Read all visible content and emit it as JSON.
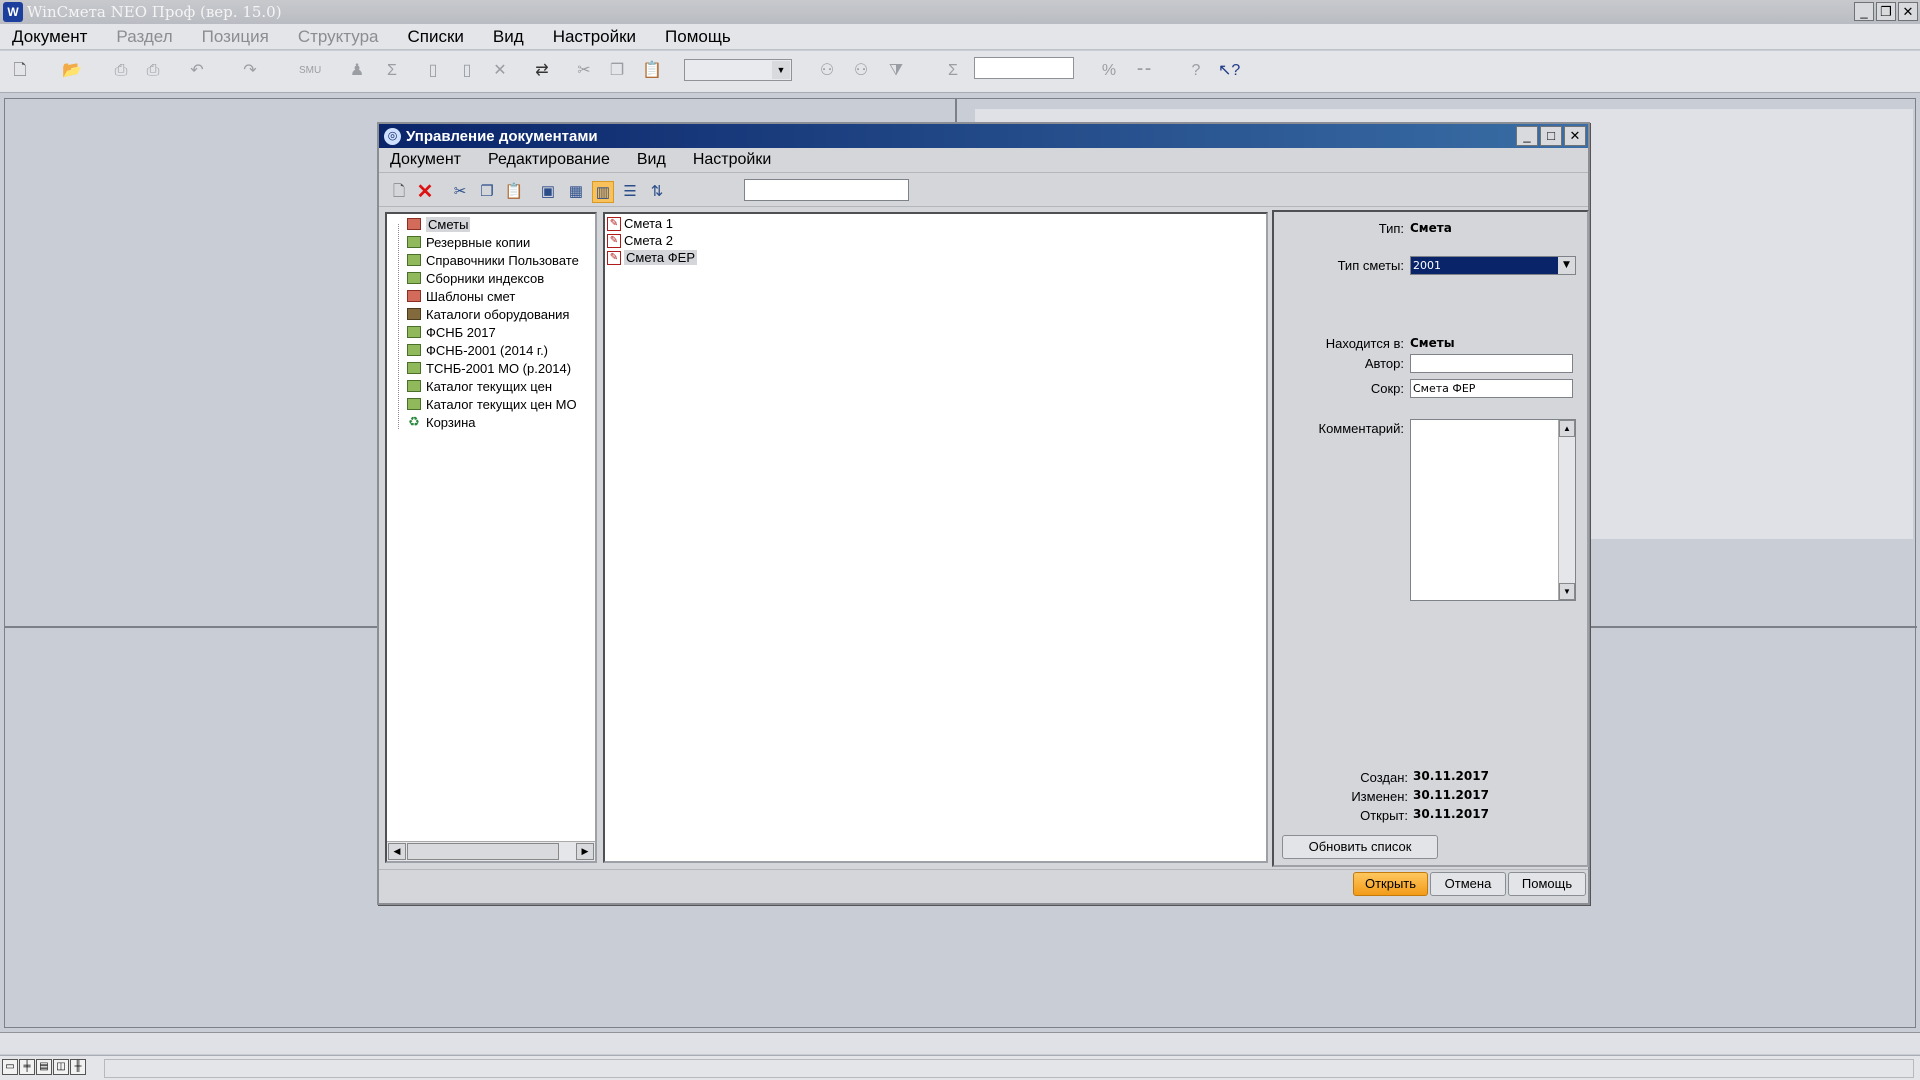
{
  "app": {
    "title": "WinСмета NEO Проф (вер. 15.0)",
    "icon_letter": "W",
    "window_buttons": [
      "_",
      "❐",
      "✕"
    ]
  },
  "menubar": {
    "items": [
      {
        "label": "Документ",
        "enabled": true
      },
      {
        "label": "Раздел",
        "enabled": false
      },
      {
        "label": "Позиция",
        "enabled": false
      },
      {
        "label": "Структура",
        "enabled": false
      },
      {
        "label": "Списки",
        "enabled": true
      },
      {
        "label": "Вид",
        "enabled": true
      },
      {
        "label": "Настройки",
        "enabled": true
      },
      {
        "label": "Помощь",
        "enabled": true
      }
    ]
  },
  "toolbar": {
    "icons": [
      "new-document-icon",
      "open-folder-icon",
      "print-icon",
      "print-preview-icon",
      "undo-icon",
      "redo-icon",
      "abbreviation-icon",
      "person-icon",
      "sum-icon",
      "page-icon",
      "page-n-icon",
      "delete-icon",
      "transfer-icon",
      "cut-icon",
      "copy-icon",
      "paste-icon",
      "binoculars-icon",
      "find-next-icon",
      "filter-icon",
      "sigma-icon",
      "percent-icon",
      "minus-icon",
      "help-icon",
      "context-help-icon"
    ],
    "combo_value": "",
    "field_value": ""
  },
  "dialog": {
    "title": "Управление документами",
    "menu": [
      "Документ",
      "Редактирование",
      "Вид",
      "Настройки"
    ],
    "search_value": "",
    "tree": [
      {
        "label": "Сметы",
        "icon": "folder-red",
        "selected": true
      },
      {
        "label": "Резервные копии",
        "icon": "folder"
      },
      {
        "label": "Справочники Пользовате",
        "icon": "folder"
      },
      {
        "label": "Сборники индексов",
        "icon": "folder"
      },
      {
        "label": "Шаблоны смет",
        "icon": "folder-red"
      },
      {
        "label": "Каталоги оборудования",
        "icon": "book"
      },
      {
        "label": "ФСНБ 2017",
        "icon": "folder"
      },
      {
        "label": "ФСНБ-2001 (2014 г.)",
        "icon": "folder"
      },
      {
        "label": "ТСНБ-2001 МО (р.2014)",
        "icon": "folder"
      },
      {
        "label": "Каталог текущих цен",
        "icon": "folder"
      },
      {
        "label": "Каталог текущих цен МО",
        "icon": "folder"
      },
      {
        "label": "Корзина",
        "icon": "trash"
      }
    ],
    "files": [
      {
        "label": "Смета 1",
        "selected": false
      },
      {
        "label": "Смета 2",
        "selected": false
      },
      {
        "label": "Смета ФЕР",
        "selected": true
      }
    ],
    "props": {
      "type_label": "Тип:",
      "type_value": "Смета",
      "estimate_type_label": "Тип сметы:",
      "estimate_type_value": "2001",
      "location_label": "Находится в:",
      "location_value": "Сметы",
      "author_label": "Автор:",
      "author_value": "",
      "short_label": "Сокр:",
      "short_value": "Смета ФЕР",
      "comment_label": "Комментарий:",
      "comment_value": "",
      "created_label": "Создан:",
      "created_value": "30.11.2017",
      "modified_label": "Изменен:",
      "modified_value": "30.11.2017",
      "opened_label": "Открыт:",
      "opened_value": "30.11.2017",
      "refresh_button": "Обновить список"
    },
    "buttons": {
      "open": "Открыть",
      "cancel": "Отмена",
      "help": "Помощь"
    }
  }
}
